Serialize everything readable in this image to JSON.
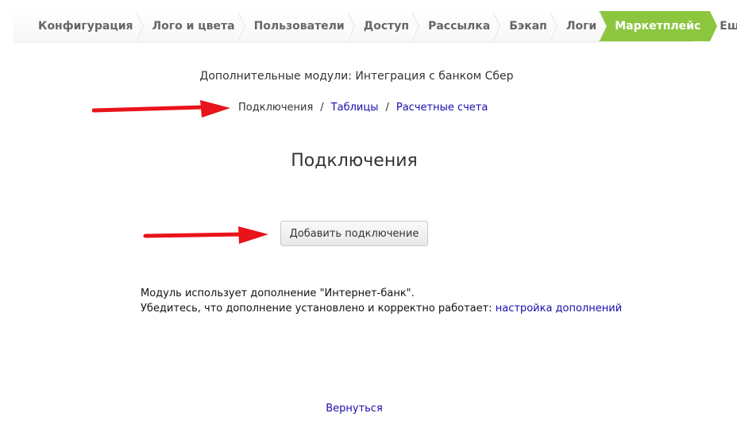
{
  "tabs": [
    {
      "label": "Конфигурация",
      "active": false
    },
    {
      "label": "Лого и цвета",
      "active": false
    },
    {
      "label": "Пользователи",
      "active": false
    },
    {
      "label": "Доступ",
      "active": false
    },
    {
      "label": "Рассылка",
      "active": false
    },
    {
      "label": "Бэкап",
      "active": false
    },
    {
      "label": "Логи",
      "active": false
    },
    {
      "label": "Маркетплейс",
      "active": true
    },
    {
      "label": "Еще",
      "active": false
    }
  ],
  "subtitle": "Дополнительные модули: Интеграция с банком Сбер",
  "breadcrumb": {
    "current": "Подключения",
    "separator": "/",
    "links": [
      "Таблицы",
      "Расчетные счета"
    ]
  },
  "heading": "Подключения",
  "add_button_label": "Добавить подключение",
  "note": {
    "line1": "Модуль использует дополнение \"Интернет-банк\".",
    "line2_text": "Убедитесь, что дополнение установлено и корректно работает:",
    "line2_link": "настройка дополнений"
  },
  "back_link": "Вернуться",
  "colors": {
    "active_tab": "#8cc63f",
    "link": "#1a0dab",
    "annotation_arrow": "#e8141a"
  }
}
